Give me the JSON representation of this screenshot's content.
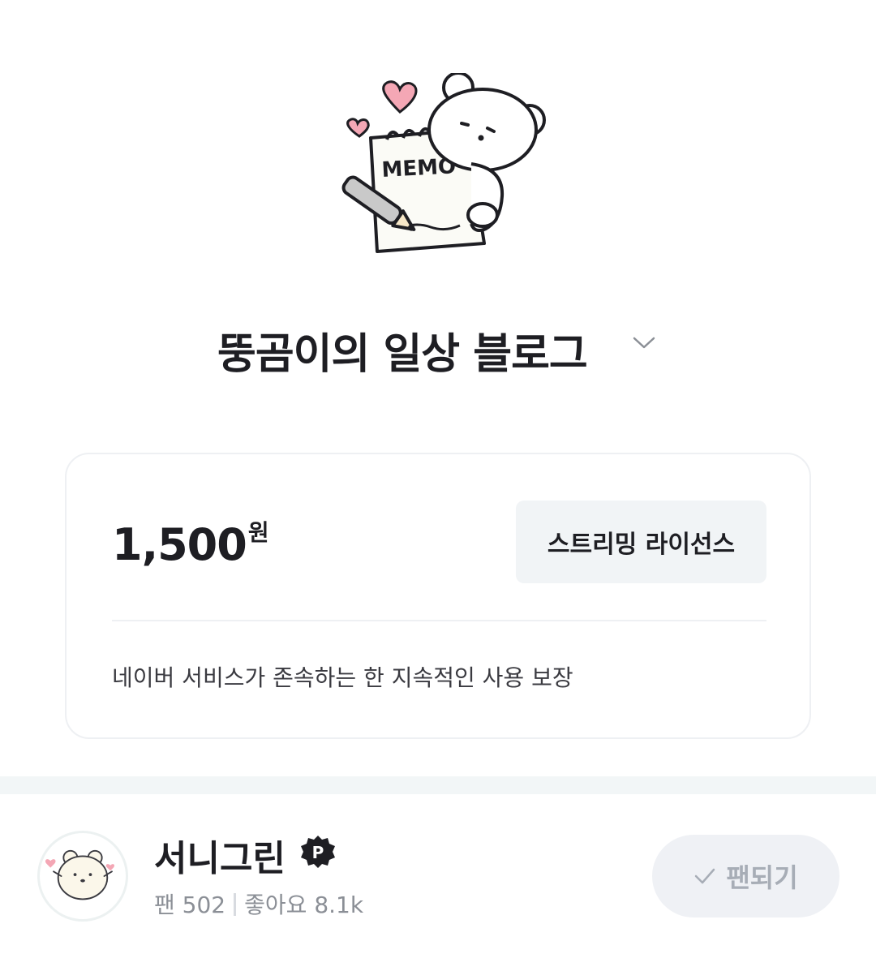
{
  "product": {
    "title": "뚱곰이의 일상 블로그",
    "illustration_text": "MEMO"
  },
  "price_card": {
    "amount": "1,500",
    "unit": "원",
    "license_button_label": "스트리밍 라이선스",
    "note": "네이버 서비스가 존속하는 한 지속적인 사용 보장"
  },
  "creator": {
    "name": "서니그린",
    "badge_letter": "P",
    "fans_label": "팬",
    "fans_count": "502",
    "likes_label": "좋아요",
    "likes_count": "8.1k",
    "fan_button_label": "팬되기"
  },
  "colors": {
    "text_primary": "#1e1e23",
    "text_secondary": "#8b8f96",
    "button_bg": "#f1f4f6",
    "fan_button_text": "#a7adb6",
    "heart_pink": "#f4a7b5"
  },
  "icons": [
    "heart-icon",
    "chevron-down-icon",
    "premium-badge-icon",
    "check-icon"
  ]
}
